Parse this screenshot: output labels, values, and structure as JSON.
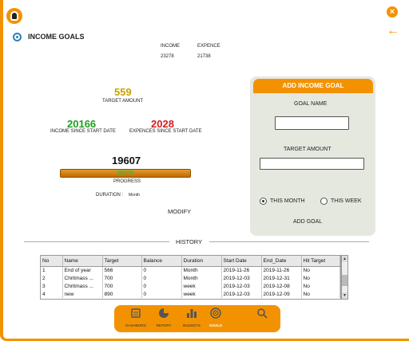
{
  "header": {
    "title": "INCOME GOALS",
    "income_label": "INCOME",
    "income_value": "23278",
    "expence_label": "EXPENCE",
    "expence_value": "21738"
  },
  "summary": {
    "target_amount": "559",
    "target_amount_label": "TARGET AMOUNT",
    "income_since": "20166",
    "income_since_label": "INCOME SINCE START DATE",
    "expences_since": "2028",
    "expences_since_label": "EXPENCES SINCE START DATE",
    "balance": "19607",
    "progress_text": "3507%",
    "progress_fraction": 1.0,
    "progress_label": "PROGRESS",
    "duration_label": "DURATION :",
    "duration_value": "Month",
    "modify_label": "MODIFY"
  },
  "add_goal_panel": {
    "header": "ADD INCOME GOAL",
    "goal_name_label": "GOAL NAME",
    "goal_name_value": "",
    "target_amount_label": "TARGET AMOUNT",
    "target_amount_value": "",
    "option_month": "THIS MONTH",
    "option_week": "THIS WEEK",
    "selected": "THIS MONTH",
    "add_button": "ADD GOAL"
  },
  "history": {
    "title": "HISTORY",
    "columns": [
      "No",
      "Name",
      "Target",
      "Balance",
      "Duration",
      "Start Date",
      "End_Date",
      "Hit Target"
    ],
    "rows": [
      [
        "1",
        "End of year",
        "566",
        "0",
        "Month",
        "2019-11-26",
        "2019-11-26",
        "No"
      ],
      [
        "2",
        "Chritmass ...",
        "700",
        "0",
        "Month",
        "2019-12-03",
        "2019-12-31",
        "No"
      ],
      [
        "3",
        "Chritmass ...",
        "700",
        "0",
        "week",
        "2019-12-03",
        "2019-12-08",
        "No"
      ],
      [
        "4",
        "new",
        "890",
        "0",
        "week",
        "2019-12-03",
        "2019-12-09",
        "No"
      ]
    ]
  },
  "nav": {
    "items": [
      {
        "label": "DASHBORD",
        "icon": "dashboard-icon"
      },
      {
        "label": "REPORT",
        "icon": "pie-chart-icon"
      },
      {
        "label": "BUDGETS",
        "icon": "bar-chart-icon"
      },
      {
        "label": "GOALS",
        "icon": "target-icon"
      },
      {
        "label": "",
        "icon": "search-icon"
      }
    ],
    "active": "GOALS"
  },
  "colors": {
    "accent": "#f39200",
    "income_green": "#1fa01f",
    "expence_red": "#d41e1e",
    "target_gold": "#c9a200",
    "panel_bg": "#e5e8df"
  }
}
